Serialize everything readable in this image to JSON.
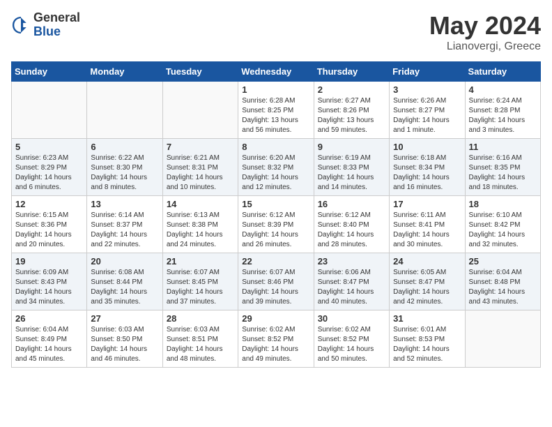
{
  "header": {
    "logo_general": "General",
    "logo_blue": "Blue",
    "month_title": "May 2024",
    "location": "Lianovergi, Greece"
  },
  "weekdays": [
    "Sunday",
    "Monday",
    "Tuesday",
    "Wednesday",
    "Thursday",
    "Friday",
    "Saturday"
  ],
  "weeks": [
    [
      {
        "day": "",
        "info": ""
      },
      {
        "day": "",
        "info": ""
      },
      {
        "day": "",
        "info": ""
      },
      {
        "day": "1",
        "info": "Sunrise: 6:28 AM\nSunset: 8:25 PM\nDaylight: 13 hours\nand 56 minutes."
      },
      {
        "day": "2",
        "info": "Sunrise: 6:27 AM\nSunset: 8:26 PM\nDaylight: 13 hours\nand 59 minutes."
      },
      {
        "day": "3",
        "info": "Sunrise: 6:26 AM\nSunset: 8:27 PM\nDaylight: 14 hours\nand 1 minute."
      },
      {
        "day": "4",
        "info": "Sunrise: 6:24 AM\nSunset: 8:28 PM\nDaylight: 14 hours\nand 3 minutes."
      }
    ],
    [
      {
        "day": "5",
        "info": "Sunrise: 6:23 AM\nSunset: 8:29 PM\nDaylight: 14 hours\nand 6 minutes."
      },
      {
        "day": "6",
        "info": "Sunrise: 6:22 AM\nSunset: 8:30 PM\nDaylight: 14 hours\nand 8 minutes."
      },
      {
        "day": "7",
        "info": "Sunrise: 6:21 AM\nSunset: 8:31 PM\nDaylight: 14 hours\nand 10 minutes."
      },
      {
        "day": "8",
        "info": "Sunrise: 6:20 AM\nSunset: 8:32 PM\nDaylight: 14 hours\nand 12 minutes."
      },
      {
        "day": "9",
        "info": "Sunrise: 6:19 AM\nSunset: 8:33 PM\nDaylight: 14 hours\nand 14 minutes."
      },
      {
        "day": "10",
        "info": "Sunrise: 6:18 AM\nSunset: 8:34 PM\nDaylight: 14 hours\nand 16 minutes."
      },
      {
        "day": "11",
        "info": "Sunrise: 6:16 AM\nSunset: 8:35 PM\nDaylight: 14 hours\nand 18 minutes."
      }
    ],
    [
      {
        "day": "12",
        "info": "Sunrise: 6:15 AM\nSunset: 8:36 PM\nDaylight: 14 hours\nand 20 minutes."
      },
      {
        "day": "13",
        "info": "Sunrise: 6:14 AM\nSunset: 8:37 PM\nDaylight: 14 hours\nand 22 minutes."
      },
      {
        "day": "14",
        "info": "Sunrise: 6:13 AM\nSunset: 8:38 PM\nDaylight: 14 hours\nand 24 minutes."
      },
      {
        "day": "15",
        "info": "Sunrise: 6:12 AM\nSunset: 8:39 PM\nDaylight: 14 hours\nand 26 minutes."
      },
      {
        "day": "16",
        "info": "Sunrise: 6:12 AM\nSunset: 8:40 PM\nDaylight: 14 hours\nand 28 minutes."
      },
      {
        "day": "17",
        "info": "Sunrise: 6:11 AM\nSunset: 8:41 PM\nDaylight: 14 hours\nand 30 minutes."
      },
      {
        "day": "18",
        "info": "Sunrise: 6:10 AM\nSunset: 8:42 PM\nDaylight: 14 hours\nand 32 minutes."
      }
    ],
    [
      {
        "day": "19",
        "info": "Sunrise: 6:09 AM\nSunset: 8:43 PM\nDaylight: 14 hours\nand 34 minutes."
      },
      {
        "day": "20",
        "info": "Sunrise: 6:08 AM\nSunset: 8:44 PM\nDaylight: 14 hours\nand 35 minutes."
      },
      {
        "day": "21",
        "info": "Sunrise: 6:07 AM\nSunset: 8:45 PM\nDaylight: 14 hours\nand 37 minutes."
      },
      {
        "day": "22",
        "info": "Sunrise: 6:07 AM\nSunset: 8:46 PM\nDaylight: 14 hours\nand 39 minutes."
      },
      {
        "day": "23",
        "info": "Sunrise: 6:06 AM\nSunset: 8:47 PM\nDaylight: 14 hours\nand 40 minutes."
      },
      {
        "day": "24",
        "info": "Sunrise: 6:05 AM\nSunset: 8:47 PM\nDaylight: 14 hours\nand 42 minutes."
      },
      {
        "day": "25",
        "info": "Sunrise: 6:04 AM\nSunset: 8:48 PM\nDaylight: 14 hours\nand 43 minutes."
      }
    ],
    [
      {
        "day": "26",
        "info": "Sunrise: 6:04 AM\nSunset: 8:49 PM\nDaylight: 14 hours\nand 45 minutes."
      },
      {
        "day": "27",
        "info": "Sunrise: 6:03 AM\nSunset: 8:50 PM\nDaylight: 14 hours\nand 46 minutes."
      },
      {
        "day": "28",
        "info": "Sunrise: 6:03 AM\nSunset: 8:51 PM\nDaylight: 14 hours\nand 48 minutes."
      },
      {
        "day": "29",
        "info": "Sunrise: 6:02 AM\nSunset: 8:52 PM\nDaylight: 14 hours\nand 49 minutes."
      },
      {
        "day": "30",
        "info": "Sunrise: 6:02 AM\nSunset: 8:52 PM\nDaylight: 14 hours\nand 50 minutes."
      },
      {
        "day": "31",
        "info": "Sunrise: 6:01 AM\nSunset: 8:53 PM\nDaylight: 14 hours\nand 52 minutes."
      },
      {
        "day": "",
        "info": ""
      }
    ]
  ]
}
